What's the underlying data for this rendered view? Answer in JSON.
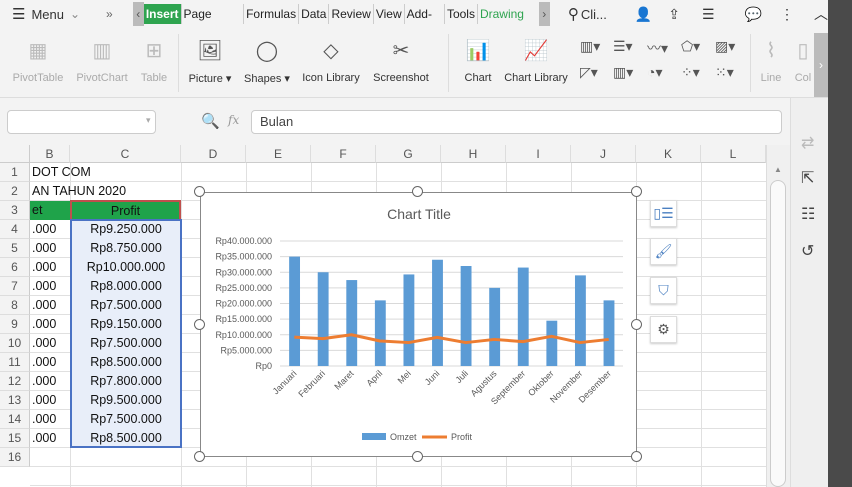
{
  "topbar": {
    "menu": "Menu",
    "more": "»",
    "tabs": [
      "Insert",
      "Page Layout",
      "Formulas",
      "Data",
      "Review",
      "View",
      "Add-Ins",
      "Tools"
    ],
    "drawing_tab": "Drawing Too",
    "search": "Cli..."
  },
  "ribbon": {
    "pivot_table": "PivotTable",
    "pivot_chart": "PivotChart",
    "table": "Table",
    "picture": "Picture",
    "shapes": "Shapes",
    "icon_library": "Icon Library",
    "screenshot": "Screenshot",
    "chart": "Chart",
    "chart_library": "Chart Library",
    "line": "Line",
    "col": "Col"
  },
  "formula": {
    "name_box": "",
    "fx": "fx",
    "value": "Bulan"
  },
  "columns": [
    "B",
    "C",
    "D",
    "E",
    "F",
    "G",
    "H",
    "I",
    "J",
    "K",
    "L"
  ],
  "rows": [
    "1",
    "2",
    "3",
    "4",
    "5",
    "6",
    "7",
    "8",
    "9",
    "10",
    "11",
    "12",
    "13",
    "14",
    "15",
    "16"
  ],
  "cells": {
    "a1": "DOT COM",
    "a2": "AN TAHUN 2020",
    "b3": "et",
    "c3": "Profit",
    "omzet_tail": [
      ".000",
      ".000",
      ".000",
      ".000",
      ".000",
      ".000",
      ".000",
      ".000",
      ".000",
      ".000",
      ".000",
      ".000"
    ],
    "profit": [
      "Rp9.250.000",
      "Rp8.750.000",
      "Rp10.000.000",
      "Rp8.000.000",
      "Rp7.500.000",
      "Rp9.150.000",
      "Rp7.500.000",
      "Rp8.500.000",
      "Rp7.800.000",
      "Rp9.500.000",
      "Rp7.500.000",
      "Rp8.500.000"
    ]
  },
  "colors": {
    "header_green": "#1fa34a",
    "bar": "#5b9bd5",
    "line": "#ed7d31",
    "accent": "#2ea44f"
  },
  "chart_data": {
    "type": "bar",
    "title": "Chart Title",
    "categories": [
      "Januari",
      "Februari",
      "Maret",
      "April",
      "Mei",
      "Juni",
      "Juli",
      "Agustus",
      "September",
      "Oktober",
      "November",
      "Desember"
    ],
    "series": [
      {
        "name": "Omzet",
        "type": "bar",
        "values": [
          35000000,
          30000000,
          27500000,
          21000000,
          29300000,
          34000000,
          32000000,
          25000000,
          31500000,
          14500000,
          29000000,
          21000000
        ]
      },
      {
        "name": "Profit",
        "type": "line",
        "values": [
          9250000,
          8750000,
          10000000,
          8000000,
          7500000,
          9150000,
          7500000,
          8500000,
          7800000,
          9500000,
          7500000,
          8500000
        ]
      }
    ],
    "yticks": [
      "Rp0",
      "Rp5.000.000",
      "Rp10.000.000",
      "Rp15.000.000",
      "Rp20.000.000",
      "Rp25.000.000",
      "Rp30.000.000",
      "Rp35.000.000",
      "Rp40.000.000"
    ],
    "ylim": [
      0,
      40000000
    ],
    "grid": true,
    "legend": "bottom"
  }
}
